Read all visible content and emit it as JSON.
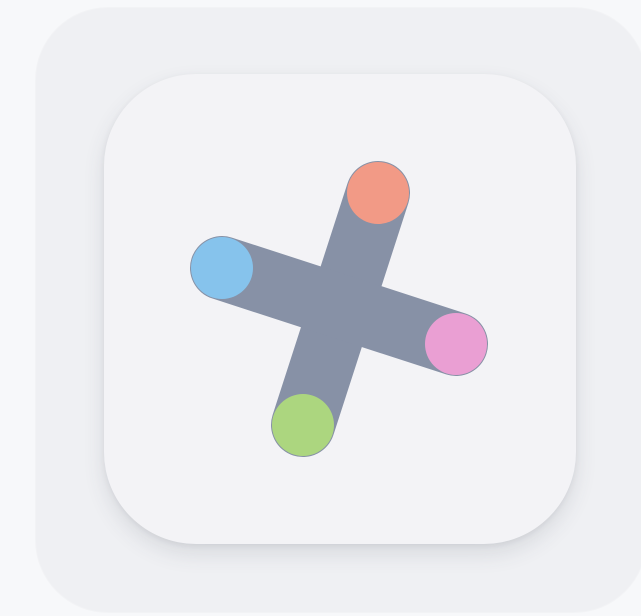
{
  "app_icon": {
    "name": "",
    "background_color": "#f3f3f6",
    "frame_color": "#eff0f3",
    "symbol": "plus-cross-icon",
    "arm_color": "#8791a6",
    "dot_colors": {
      "top": "#f29a86",
      "left": "#86c3ec",
      "right": "#ea9fd3",
      "bottom": "#acd67f"
    }
  }
}
